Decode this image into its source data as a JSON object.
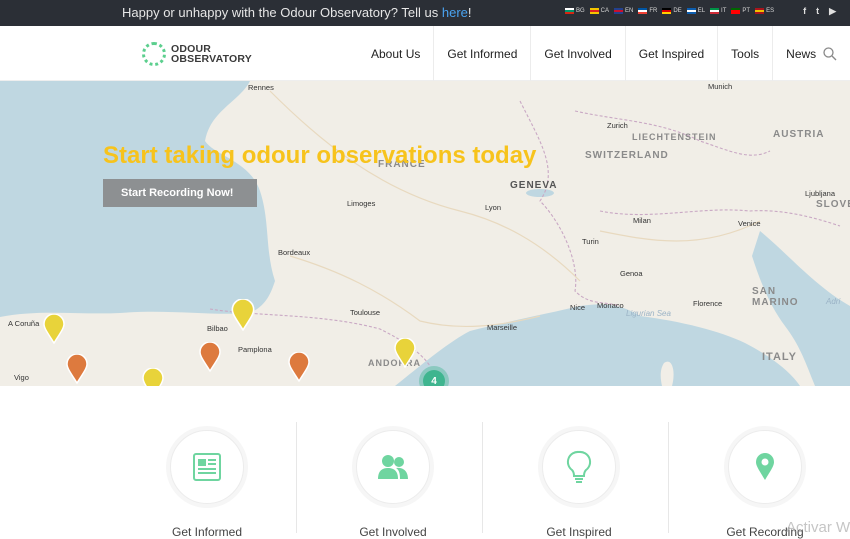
{
  "topbar": {
    "message_prefix": "Happy or unhappy with the Odour Observatory? Tell us ",
    "message_link": "here",
    "message_suffix": "!",
    "languages": [
      {
        "code": "BG",
        "colors": [
          "#ffffff",
          "#00966e",
          "#d62612"
        ]
      },
      {
        "code": "CA",
        "colors": [
          "#f4c400",
          "#d22",
          "#f4c400"
        ]
      },
      {
        "code": "EN",
        "colors": [
          "#23408e",
          "#c8102e",
          "#23408e"
        ]
      },
      {
        "code": "FR",
        "colors": [
          "#0055a4",
          "#ffffff",
          "#ef4135"
        ]
      },
      {
        "code": "DE",
        "colors": [
          "#000000",
          "#dd0000",
          "#ffce00"
        ]
      },
      {
        "code": "EL",
        "colors": [
          "#0d5eaf",
          "#ffffff",
          "#0d5eaf"
        ]
      },
      {
        "code": "IT",
        "colors": [
          "#009246",
          "#ffffff",
          "#ce2b37"
        ]
      },
      {
        "code": "PT",
        "colors": [
          "#006600",
          "#ff0000",
          "#ff0000"
        ]
      },
      {
        "code": "ES",
        "colors": [
          "#aa151b",
          "#f1bf00",
          "#aa151b"
        ]
      }
    ],
    "social": [
      {
        "icon": "facebook-icon",
        "glyph": "f"
      },
      {
        "icon": "twitter-icon",
        "glyph": "t"
      },
      {
        "icon": "youtube-icon",
        "glyph": "▶"
      }
    ]
  },
  "header": {
    "logo_line1": "ODOUR",
    "logo_line2": "OBSERVATORY",
    "nav": [
      "About Us",
      "Get Informed",
      "Get Involved",
      "Get Inspired",
      "Tools",
      "News"
    ]
  },
  "hero": {
    "title": "Start taking odour observations today",
    "button": "Start Recording Now!",
    "cluster_count": "4",
    "cities": [
      "Rennes",
      "Munich",
      "Zurich",
      "Limoges",
      "Lyon",
      "Bordeaux",
      "Turin",
      "Milan",
      "Venice",
      "Genoa",
      "Ljubljana",
      "Florence",
      "Nice",
      "Monaco",
      "Marseille",
      "Toulouse",
      "Bilbao",
      "Pamplona",
      "A Coruña",
      "Vigo"
    ],
    "countries": [
      "FRANCE",
      "GENEVA",
      "LIECHTENSTEIN",
      "AUSTRIA",
      "SWITZERLAND",
      "SLOVE",
      "SAN MARINO",
      "ITALY",
      "ANDORRA"
    ],
    "seas": [
      "Ligurian Sea",
      "Adri"
    ],
    "colors": {
      "title": "#f7c31c",
      "yellow_pin": "#e8d33a",
      "orange_pin": "#dd7a3e",
      "cluster": "#3fb58f"
    }
  },
  "features": [
    {
      "label": "Get Informed",
      "icon": "newspaper-icon"
    },
    {
      "label": "Get Involved",
      "icon": "users-icon"
    },
    {
      "label": "Get Inspired",
      "icon": "lightbulb-icon"
    },
    {
      "label": "Get Recording",
      "icon": "map-marker-icon"
    }
  ],
  "watermark": "Activar W",
  "accent": "#5ccf8e"
}
